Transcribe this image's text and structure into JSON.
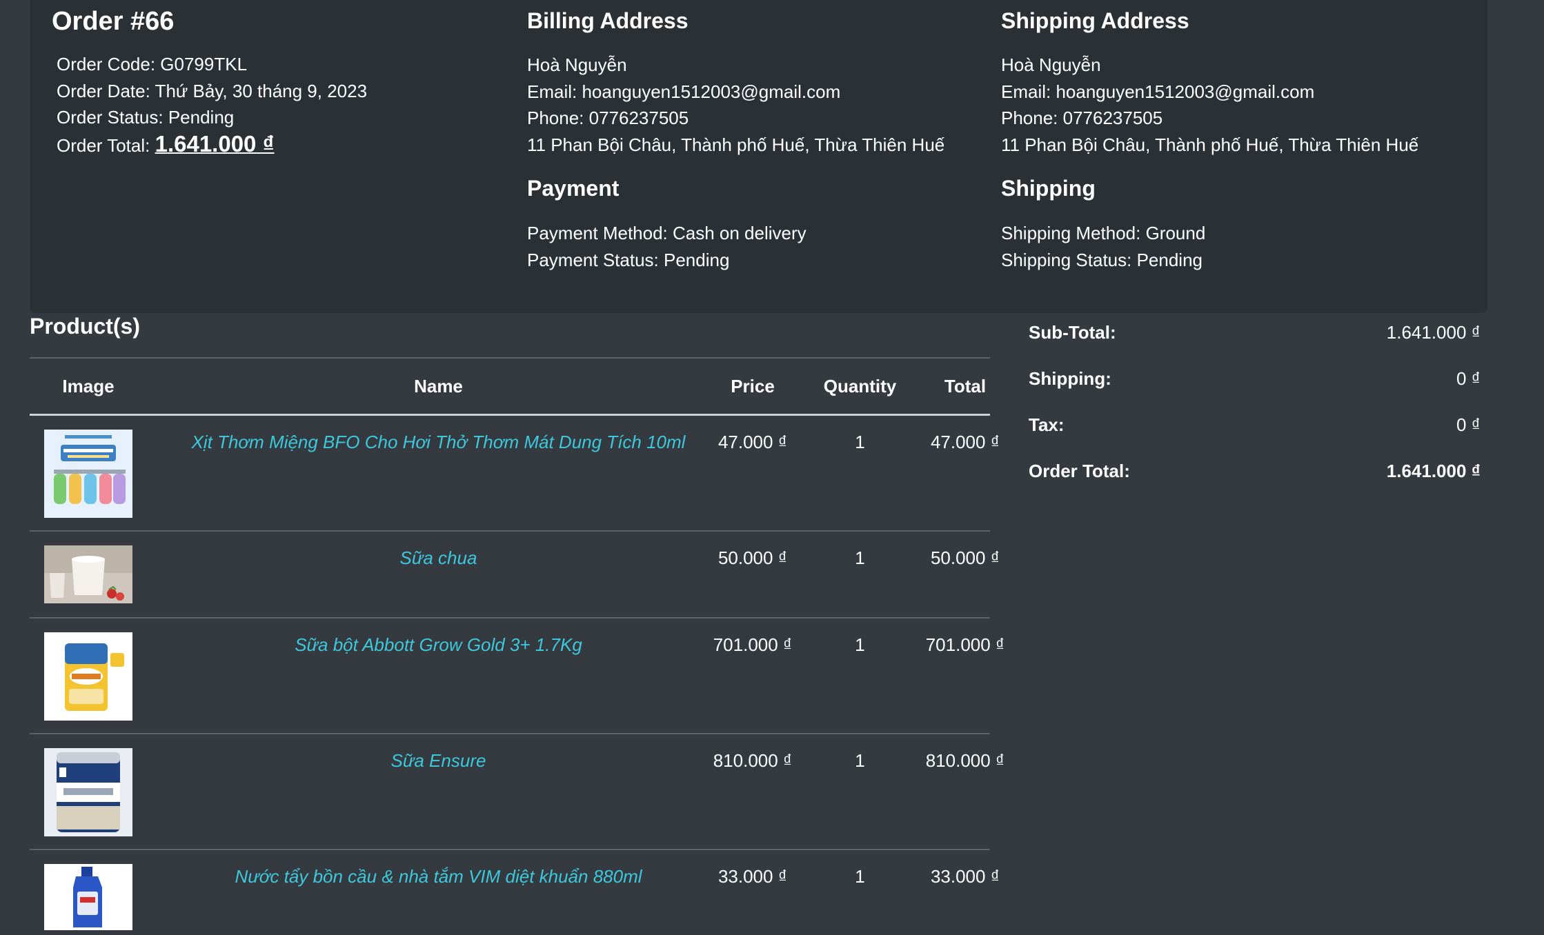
{
  "order": {
    "title": "Order #66",
    "code": "Order Code: G0799TKL",
    "date": "Order Date: Thứ Bảy, 30 tháng 9, 2023",
    "status": "Order Status: Pending",
    "total_label": "Order Total: ",
    "total_value": "1.641.000 ₫"
  },
  "billing": {
    "title": "Billing Address",
    "name": "Hoà Nguyễn",
    "email": "Email: hoanguyen1512003@gmail.com",
    "phone": "Phone: 0776237505",
    "address": "11 Phan Bội Châu, Thành phố Huế, Thừa Thiên Huế"
  },
  "shipping_address": {
    "title": "Shipping Address",
    "name": "Hoà Nguyễn",
    "email": "Email: hoanguyen1512003@gmail.com",
    "phone": "Phone: 0776237505",
    "address": "11 Phan Bội Châu, Thành phố Huế, Thừa Thiên Huế"
  },
  "payment": {
    "title": "Payment",
    "method": "Payment Method: Cash on delivery",
    "status": "Payment Status: Pending"
  },
  "shipping": {
    "title": "Shipping",
    "method": "Shipping Method: Ground",
    "status": "Shipping Status: Pending"
  },
  "products": {
    "title": "Product(s)",
    "headers": [
      "Image",
      "Name",
      "Price",
      "Quantity",
      "Total"
    ],
    "rows": [
      {
        "name": "Xịt Thơm Miệng BFO Cho Hơi Thở Thơm Mát Dung Tích 10ml",
        "price": "47.000 ₫",
        "quantity": "1",
        "total": "47.000 ₫"
      },
      {
        "name": "Sữa chua",
        "price": "50.000 ₫",
        "quantity": "1",
        "total": "50.000 ₫"
      },
      {
        "name": "Sữa bột Abbott Grow Gold 3+ 1.7Kg",
        "price": "701.000 ₫",
        "quantity": "1",
        "total": "701.000 ₫"
      },
      {
        "name": "Sữa Ensure",
        "price": "810.000 ₫",
        "quantity": "1",
        "total": "810.000 ₫"
      },
      {
        "name": "Nước tẩy bồn cầu & nhà tắm VIM diệt khuẩn 880ml",
        "price": "33.000 ₫",
        "quantity": "1",
        "total": "33.000 ₫"
      }
    ]
  },
  "summary": {
    "subtotal_label": "Sub-Total:",
    "subtotal_value": "1.641.000 ₫",
    "shipping_label": "Shipping:",
    "shipping_value": "0 ₫",
    "tax_label": "Tax:",
    "tax_value": "0 ₫",
    "total_label": "Order Total:",
    "total_value": "1.641.000 ₫"
  },
  "colors": {
    "page_bg": "#343a40",
    "card_bg": "#2b3035",
    "link": "#3dc8dc"
  }
}
